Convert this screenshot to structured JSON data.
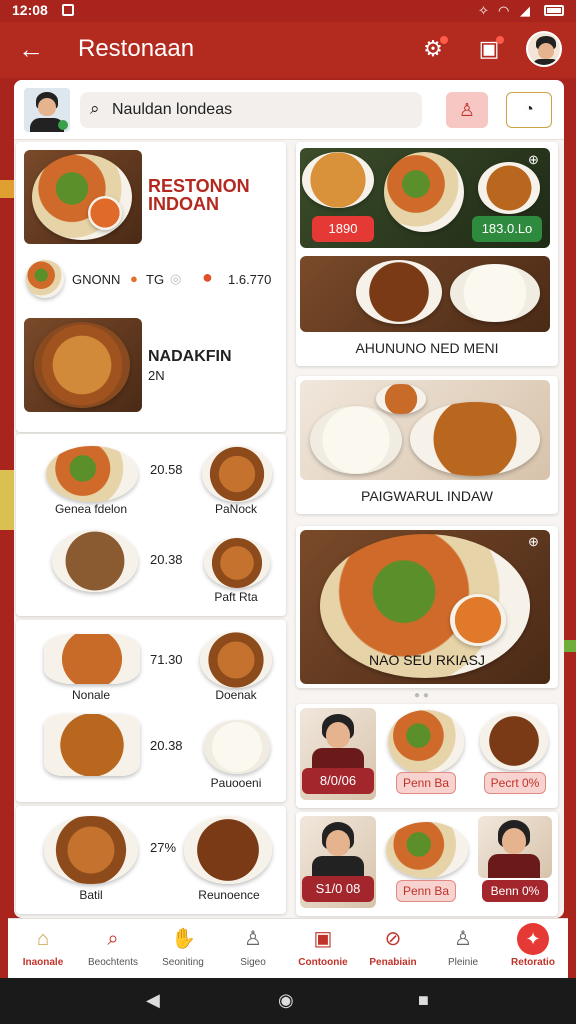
{
  "status": {
    "time": "12:08"
  },
  "appbar": {
    "title": "Restonaan"
  },
  "search": {
    "value": "Nauldan londeas"
  },
  "featured": {
    "title_line1": "RESTONON",
    "title_line2": "INDOAN",
    "meta_name": "GNONN",
    "meta_count": "TG",
    "meta_value": "1.6.770",
    "sub_title": "NADAKFIN",
    "sub_value": "2N"
  },
  "left_grid": [
    {
      "price": "20.58",
      "left_label": "Genea fdelon",
      "right_label": "PaNock"
    },
    {
      "price": "20.38",
      "left_label": "",
      "right_label": "Paft Rta"
    },
    {
      "price": "71.30",
      "left_label": "Nonale",
      "right_label": "Doenak"
    },
    {
      "price": "20.38",
      "left_label": "",
      "right_label": "Pauooeni"
    },
    {
      "price": "27%",
      "left_label": "Batil",
      "right_label": "Reunoence"
    }
  ],
  "right_cards": {
    "card1_price_left": "1890",
    "card1_price_right": "183.0.Lo",
    "card2_title": "AHUNUNO NED MENI",
    "card3_title": "PAIGWARUL INDAW",
    "card4_title": "NAO SEU RKIASJ"
  },
  "small_cards": [
    {
      "label": "8/0/06"
    },
    {
      "label": "Penn Ba"
    },
    {
      "label": "Pecrt 0%"
    },
    {
      "label": "S1/0 08"
    },
    {
      "label": "Penn Ba"
    },
    {
      "label": "Benn 0%"
    }
  ],
  "bottom_nav": [
    {
      "label": "Inaonale",
      "icon": "home-icon"
    },
    {
      "label": "Beochtents",
      "icon": "search-icon"
    },
    {
      "label": "Seoniting",
      "icon": "hand-icon"
    },
    {
      "label": "Sigeo",
      "icon": "user-icon"
    },
    {
      "label": "Contoonie",
      "icon": "box-icon"
    },
    {
      "label": "Penabiain",
      "icon": "slash-circle-icon"
    },
    {
      "label": "Pleinie",
      "icon": "person-icon"
    },
    {
      "label": "Retoratio",
      "icon": "plate-icon"
    }
  ],
  "colors": {
    "primary": "#b32a1f",
    "accent_red": "#e53935",
    "accent_green": "#2e8b3e"
  }
}
